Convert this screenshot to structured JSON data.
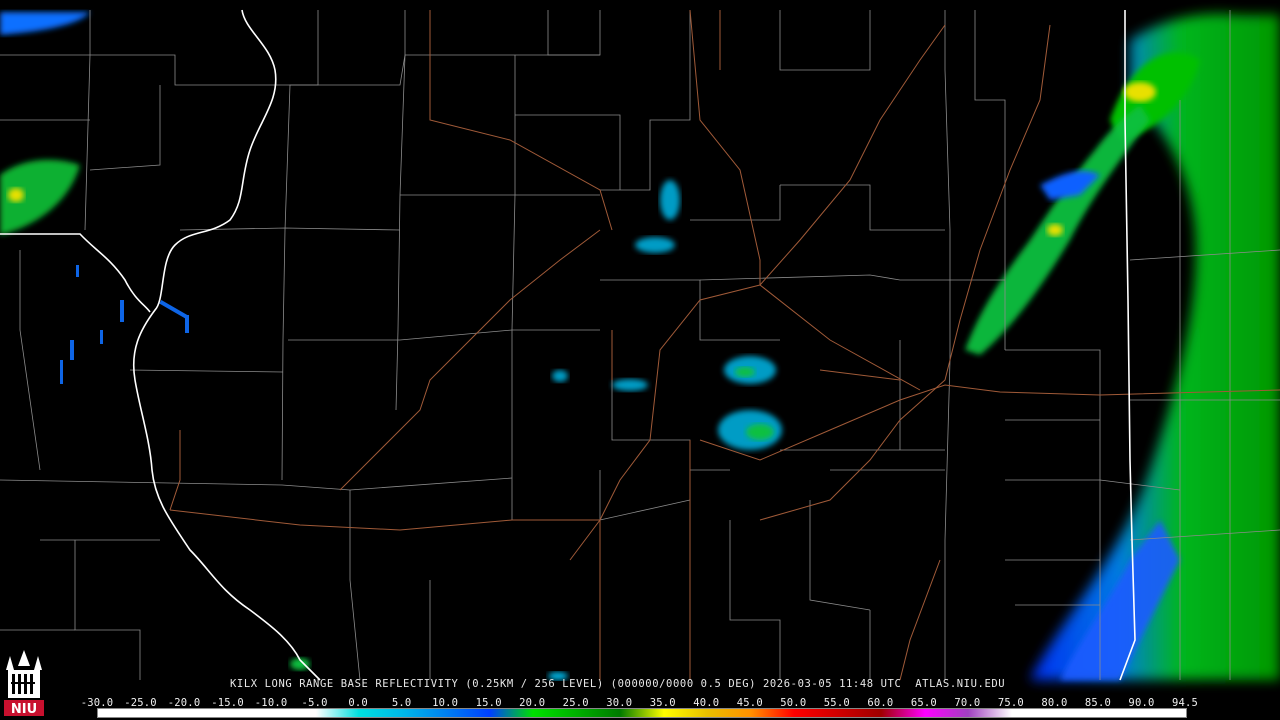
{
  "title": "KILX LONG RANGE BASE REFLECTIVITY (0.25KM / 256 LEVEL) (000000/0000 0.5 DEG) 2026-03-05 11:48 UTC  ATLAS.NIU.EDU",
  "logo_text": "NIU",
  "scale": {
    "labels": [
      "-30.0",
      "-25.0",
      "-20.0",
      "-15.0",
      "-10.0",
      "-5.0",
      "0.0",
      "5.0",
      "10.0",
      "15.0",
      "20.0",
      "25.0",
      "30.0",
      "35.0",
      "40.0",
      "45.0",
      "50.0",
      "55.0",
      "60.0",
      "65.0",
      "70.0",
      "75.0",
      "80.0",
      "85.0",
      "90.0",
      "94.5"
    ],
    "colors": [
      "#ffffff",
      "#ffffff",
      "#ffffff",
      "#ffffff",
      "#ffffff",
      "#ffffff",
      "#00e0e0",
      "#00b8e8",
      "#0080f0",
      "#0040ff",
      "#00e000",
      "#00b000",
      "#007a00",
      "#ffff00",
      "#e8c000",
      "#ff9000",
      "#ff0000",
      "#d00000",
      "#a00000",
      "#ff00ff",
      "#a040c0",
      "#ffffff",
      "#ffffff",
      "#ffffff",
      "#ffffff"
    ]
  },
  "colors": {
    "state_border": "#ffffff",
    "county_border": "#8c8c8c",
    "highway": "#a05a38",
    "background": "#000000"
  }
}
